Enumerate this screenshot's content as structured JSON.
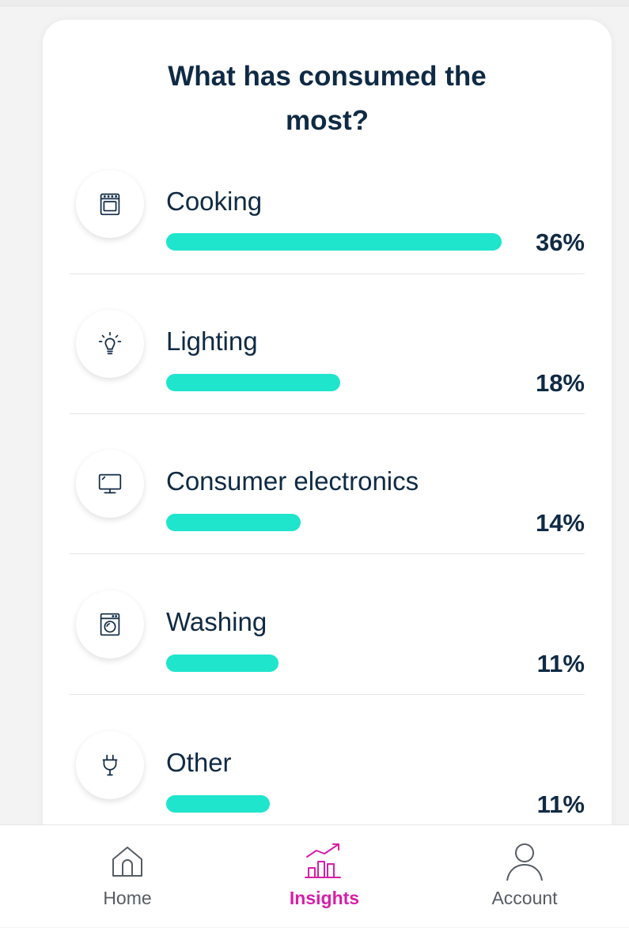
{
  "card": {
    "title": "What has consumed the most?"
  },
  "categories": [
    {
      "label": "Cooking",
      "percent_text": "36%",
      "fill": 1.0,
      "icon": "oven-icon"
    },
    {
      "label": "Lighting",
      "percent_text": "18%",
      "fill": 0.52,
      "icon": "lightbulb-icon"
    },
    {
      "label": "Consumer electronics",
      "percent_text": "14%",
      "fill": 0.4,
      "icon": "monitor-icon"
    },
    {
      "label": "Washing",
      "percent_text": "11%",
      "fill": 0.335,
      "icon": "washing-machine-icon"
    },
    {
      "label": "Other",
      "percent_text": "11%",
      "fill": 0.31,
      "icon": "plug-icon"
    }
  ],
  "nav": {
    "home": {
      "label": "Home",
      "icon": "home-icon"
    },
    "insights": {
      "label": "Insights",
      "icon": "insights-chart-icon",
      "active": true
    },
    "account": {
      "label": "Account",
      "icon": "account-person-icon"
    }
  },
  "colors": {
    "bar": "#1fe5cd",
    "text_dark": "#0f2a44",
    "active_nav": "#d61fa8",
    "inactive_nav": "#555c63"
  }
}
